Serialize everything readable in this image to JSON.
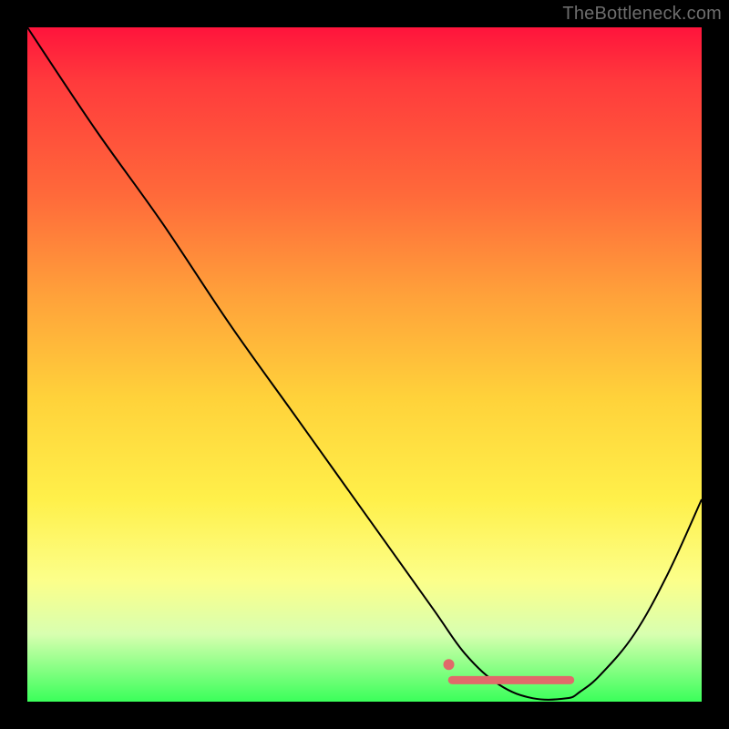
{
  "watermark": "TheBottleneck.com",
  "chart_data": {
    "type": "line",
    "title": "",
    "xlabel": "",
    "ylabel": "",
    "xlim": [
      0,
      100
    ],
    "ylim": [
      0,
      100
    ],
    "background_gradient": {
      "stops": [
        {
          "pct": 0,
          "color": "#ff143c"
        },
        {
          "pct": 8,
          "color": "#ff3a3c"
        },
        {
          "pct": 25,
          "color": "#ff6a3a"
        },
        {
          "pct": 40,
          "color": "#ffa23a"
        },
        {
          "pct": 55,
          "color": "#ffd23a"
        },
        {
          "pct": 70,
          "color": "#fff04a"
        },
        {
          "pct": 82,
          "color": "#fcff8a"
        },
        {
          "pct": 90,
          "color": "#d8ffb0"
        },
        {
          "pct": 100,
          "color": "#3aff5a"
        }
      ]
    },
    "series": [
      {
        "name": "curve",
        "color": "#000000",
        "stroke_width": 2,
        "x": [
          0.0,
          10,
          20,
          30,
          40,
          50,
          60,
          65,
          70,
          75,
          80,
          82,
          85,
          90,
          95,
          100
        ],
        "y": [
          100,
          85,
          71,
          56,
          42,
          28,
          14,
          7,
          2.5,
          0.5,
          0.5,
          1.5,
          4,
          10,
          19,
          30
        ]
      }
    ],
    "highlight": {
      "name": "pink-bar",
      "color": "#e06a6a",
      "stroke_width": 9,
      "linecap": "round",
      "x": [
        63,
        80.5
      ],
      "y": [
        3.2,
        3.2
      ],
      "end_dot_radius": 6,
      "start_x": 62.5,
      "start_y": 5.5
    }
  }
}
